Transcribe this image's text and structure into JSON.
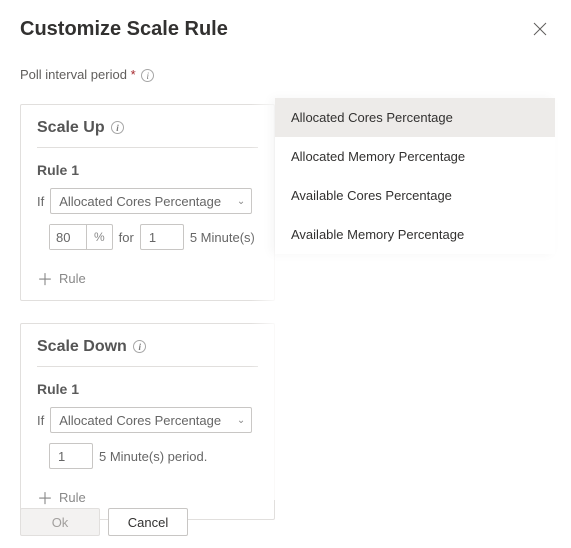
{
  "header": {
    "title": "Customize Scale Rule"
  },
  "pollInterval": {
    "label": "Poll interval period",
    "required": "*"
  },
  "scaleUp": {
    "title": "Scale Up",
    "rule": {
      "title": "Rule 1",
      "ifLabel": "If",
      "metric": "Allocated Cores Percentage",
      "threshold": "80",
      "percent": "%",
      "forLabel": "for",
      "forValue": "1",
      "periodSuffix": "5 Minute(s)"
    },
    "addRule": "Rule"
  },
  "scaleDown": {
    "title": "Scale Down",
    "rule": {
      "title": "Rule 1",
      "ifLabel": "If",
      "metric": "Allocated Cores Percentage",
      "forValue": "1",
      "periodSuffix": "5 Minute(s) period."
    },
    "addRule": "Rule"
  },
  "dropdown": {
    "items": [
      "Allocated Cores Percentage",
      "Allocated Memory Percentage",
      "Available Cores Percentage",
      "Available Memory Percentage"
    ]
  },
  "footer": {
    "ok": "Ok",
    "cancel": "Cancel"
  }
}
